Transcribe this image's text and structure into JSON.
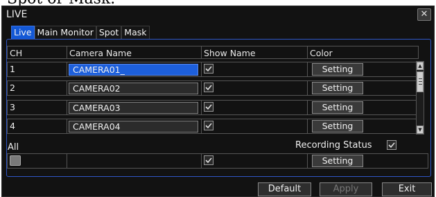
{
  "header_fragment": "Spot or Mask.",
  "window": {
    "title": "LIVE",
    "close_glyph": "✕"
  },
  "tabs": [
    {
      "label": "Live",
      "active": true
    },
    {
      "label": "Main Monitor",
      "active": false
    },
    {
      "label": "Spot",
      "active": false
    },
    {
      "label": "Mask",
      "active": false
    }
  ],
  "table": {
    "headers": [
      "CH",
      "Camera Name",
      "Show Name",
      "Color"
    ],
    "rows": [
      {
        "ch": "1",
        "name": "CAMERA01_",
        "show_name": true,
        "color_button": "Setting",
        "focused": true
      },
      {
        "ch": "2",
        "name": "CAMERA02",
        "show_name": true,
        "color_button": "Setting",
        "focused": false
      },
      {
        "ch": "3",
        "name": "CAMERA03",
        "show_name": true,
        "color_button": "Setting",
        "focused": false
      },
      {
        "ch": "4",
        "name": "CAMERA04",
        "show_name": true,
        "color_button": "Setting",
        "focused": false
      }
    ]
  },
  "all": {
    "label": "All",
    "recording_status_label": "Recording Status",
    "recording_status_checked": true,
    "all_checked": false,
    "show_name_checked": true,
    "color_button": "Setting"
  },
  "footer": {
    "default_label": "Default",
    "apply_label": "Apply",
    "exit_label": "Exit"
  },
  "colors": {
    "accent": "#1358d6",
    "panel_border": "#2f57c8",
    "background": "#121212"
  }
}
